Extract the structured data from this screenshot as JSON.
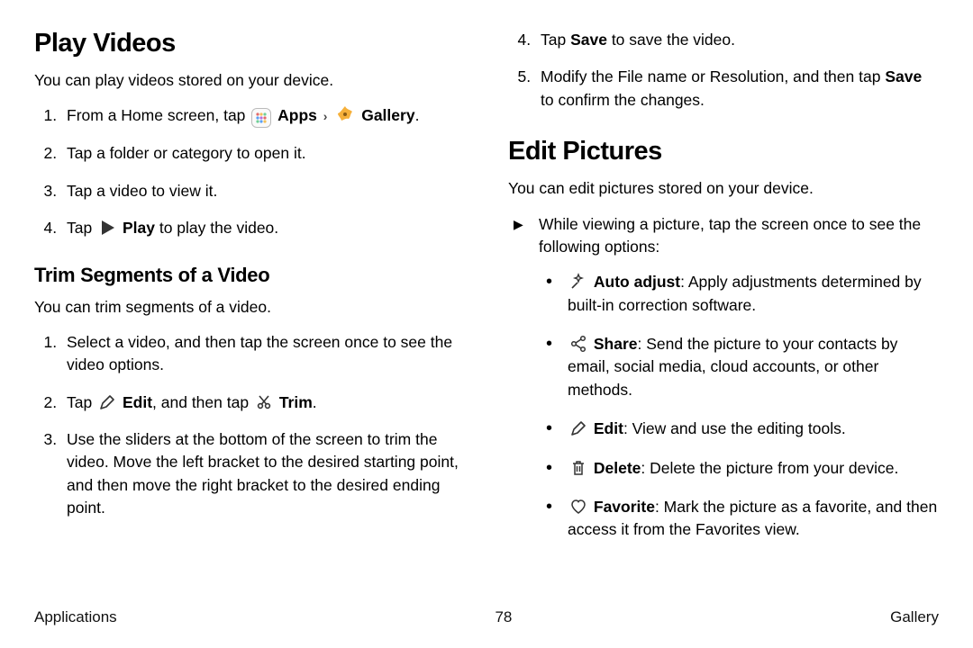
{
  "left": {
    "h1": "Play Videos",
    "intro": "You can play videos stored on your device.",
    "steps": {
      "s1a": "From a Home screen, tap",
      "s1_apps": "Apps",
      "s1_gallery": "Gallery",
      "s2": "Tap a folder or category to open it.",
      "s3": "Tap a video to view it.",
      "s4a": "Tap",
      "s4_play": "Play",
      "s4b": " to play the video."
    },
    "h2": "Trim Segments of a Video",
    "trim_intro": "You can trim segments of a video.",
    "trim": {
      "s1": "Select a video, and then tap the screen once to see the video options.",
      "s2a": "Tap",
      "s2_edit": "Edit",
      "s2b": ", and then tap",
      "s2_trim": "Trim",
      "s3": "Use the sliders at the bottom of the screen to trim the video. Move the left bracket to the desired starting point, and then move the right bracket to the desired ending point."
    }
  },
  "right": {
    "cont": {
      "s4a": "Tap ",
      "s4_save": "Save",
      "s4b": " to save the video.",
      "s5a": "Modify the File name or Resolution, and then tap ",
      "s5_save": "Save",
      "s5b": " to confirm the changes."
    },
    "h1": "Edit Pictures",
    "intro": "You can edit pictures stored on your device.",
    "arrow": "While viewing a picture, tap the screen once to see the following options:",
    "opts": {
      "auto_l": "Auto adjust",
      "auto_t": ": Apply adjustments determined by built-in correction software.",
      "share_l": "Share",
      "share_t": ": Send the picture to your contacts by email, social media, cloud accounts, or other methods.",
      "edit_l": "Edit",
      "edit_t": ": View and use the editing tools.",
      "del_l": "Delete",
      "del_t": ": Delete the picture from your device.",
      "fav_l": "Favorite",
      "fav_t": ": Mark the picture as a favorite, and then access it from the Favorites view."
    }
  },
  "footer": {
    "left": "Applications",
    "center": "78",
    "right": "Gallery"
  }
}
